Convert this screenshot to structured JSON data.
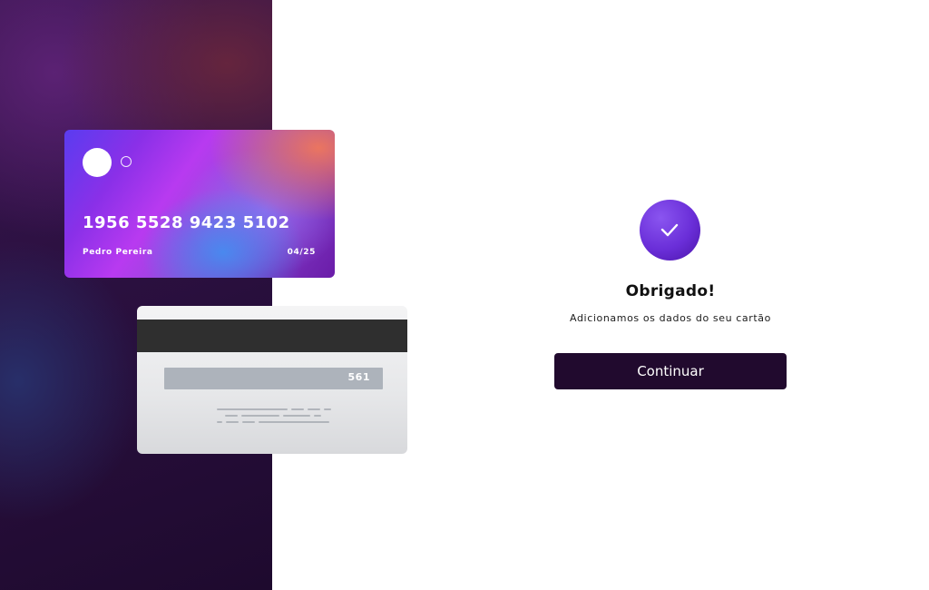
{
  "card_front": {
    "number": "1956 5528 9423 5102",
    "holder": "Pedro Pereira",
    "expiry": "04/25"
  },
  "card_back": {
    "cvv": "561"
  },
  "confirmation": {
    "icon": "check-icon",
    "title": "Obrigado!",
    "subtitle": "Adicionamos os dados do seu cartão",
    "button_label": "Continuar"
  },
  "colors": {
    "button_bg": "#210a2e",
    "accent_purple": "#6a2ed8",
    "panel_dark": "#1e0a2e"
  }
}
